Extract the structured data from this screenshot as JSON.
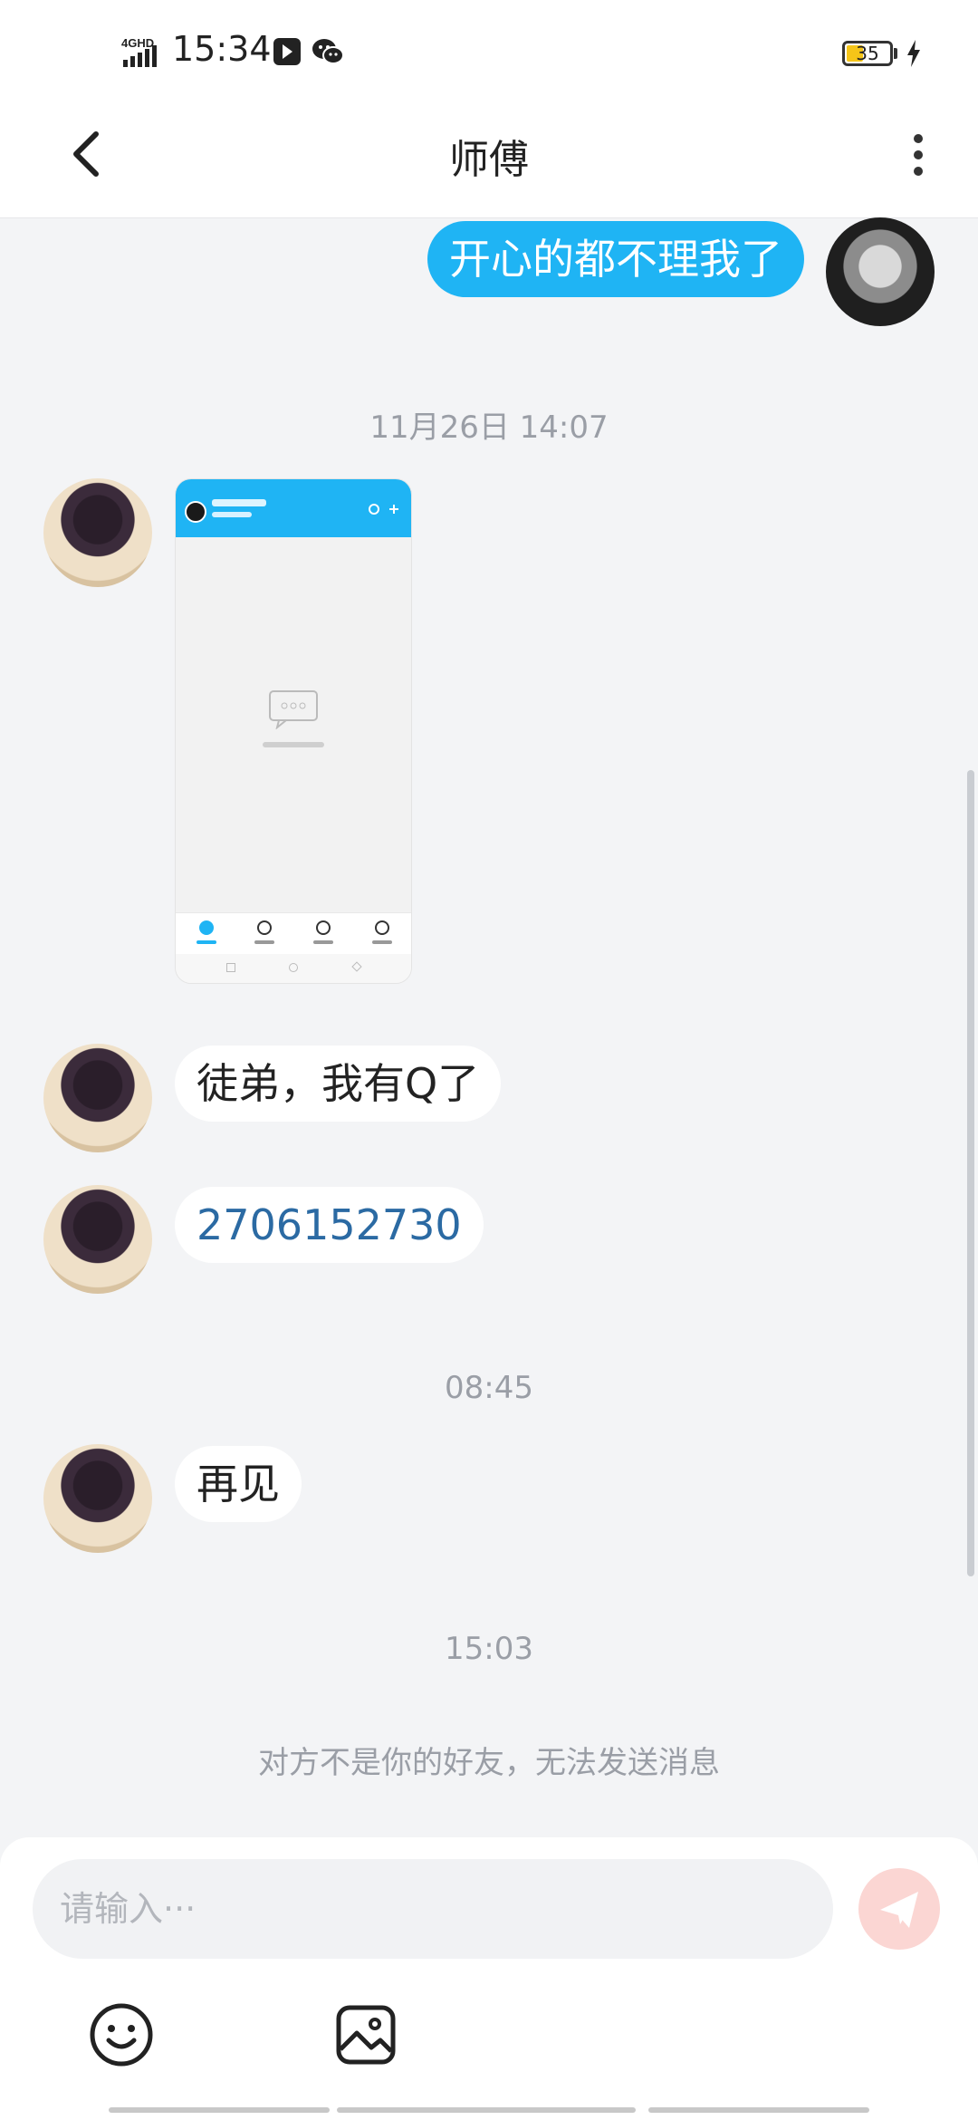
{
  "status_bar": {
    "network": "4GHD",
    "time": "15:34",
    "battery": "35"
  },
  "header": {
    "title": "师傅"
  },
  "messages": {
    "sent_1": "开心的都不理我了",
    "time_1": "11月26日 14:07",
    "received_text_1": "徒弟，我有Q了",
    "received_number": "2706152730",
    "time_2": "08:45",
    "received_text_2": "再见",
    "time_3": "15:03",
    "notice": "对方不是你的好友，无法发送消息"
  },
  "composer": {
    "placeholder": "请输入···"
  },
  "colors": {
    "accent": "#1fb4f4",
    "send_disabled": "#fbd6d3",
    "link_number": "#2b6aa3"
  },
  "icons": {
    "back": "chevron-left-icon",
    "more": "more-vertical-icon",
    "emoji": "emoji-icon",
    "image": "image-icon",
    "send": "send-icon"
  }
}
